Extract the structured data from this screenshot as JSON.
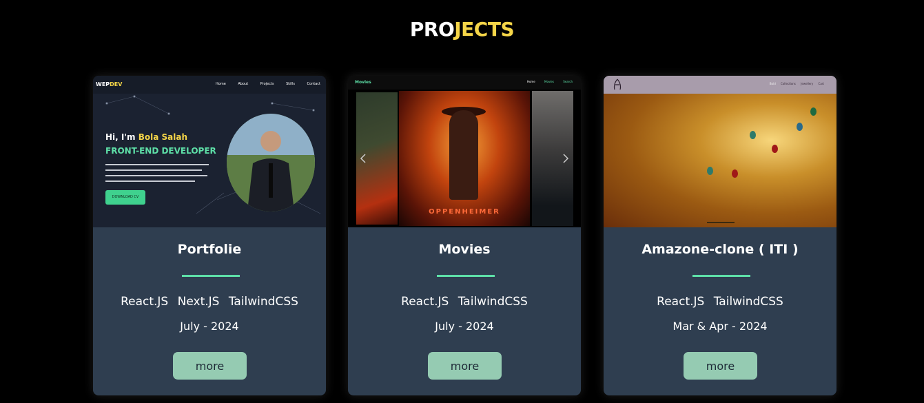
{
  "section": {
    "title_part1": "PRO",
    "title_part2": "JECTS"
  },
  "colors": {
    "accent_yellow": "#f5d548",
    "accent_green": "#5ee0a8",
    "card_bg": "#2f3e50",
    "button_bg": "#95cbb2"
  },
  "projects": [
    {
      "title": "Portfolie",
      "tags": [
        "React.JS",
        "Next.JS",
        "TailwindCSS"
      ],
      "date": "July - 2024",
      "button": "more",
      "preview": {
        "logo_a": "WEP",
        "logo_b": "DEV",
        "nav": [
          "Home",
          "About",
          "Projects",
          "Skills",
          "Contact"
        ],
        "greeting": "Hi, I'm ",
        "name": "Bola Salah",
        "role": "FRONT-END DEVELOPER",
        "cta": "DOWNLOAD CV"
      }
    },
    {
      "title": "Movies",
      "tags": [
        "React.JS",
        "TailwindCSS"
      ],
      "date": "July - 2024",
      "button": "more",
      "preview": {
        "brand": "Movies",
        "nav": [
          "Home",
          "Movies",
          "Search"
        ],
        "poster": "OPPENHEIMER"
      }
    },
    {
      "title": "Amazone-clone ( ITI )",
      "tags": [
        "React.JS",
        "TailwindCSS"
      ],
      "date": "Mar & Apr - 2024",
      "button": "more",
      "preview": {
        "nav": [
          "Bold",
          "Collections",
          "Jewellery",
          "Cart"
        ]
      }
    }
  ]
}
